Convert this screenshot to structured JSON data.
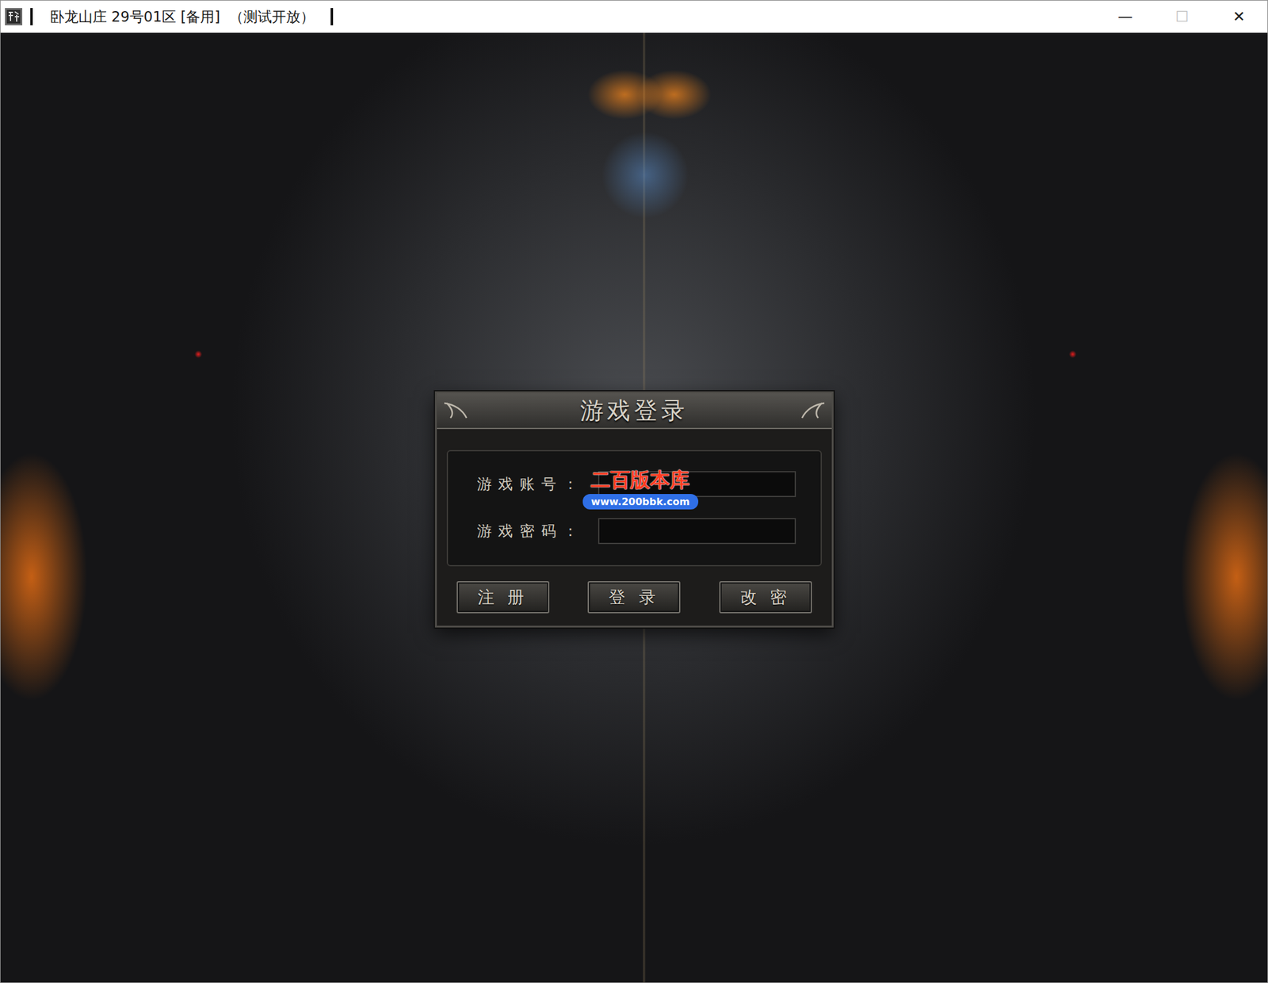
{
  "window": {
    "title": "卧龙山庄 29号01区 [备用]  （测试开放）",
    "controls": [
      {
        "label": "—",
        "disabled": false
      },
      {
        "label": "☐",
        "disabled": true
      },
      {
        "label": "✕",
        "disabled": false
      }
    ]
  },
  "dialog": {
    "title": "游戏登录",
    "fields": [
      {
        "label": "游戏账号：",
        "value": "",
        "kind": "text"
      },
      {
        "label": "游戏密码：",
        "value": "",
        "kind": "password"
      }
    ],
    "buttons": [
      "注册",
      "登录",
      "改密"
    ]
  },
  "watermark": {
    "name": "二百版本库",
    "url": "www.200bbk.com"
  }
}
